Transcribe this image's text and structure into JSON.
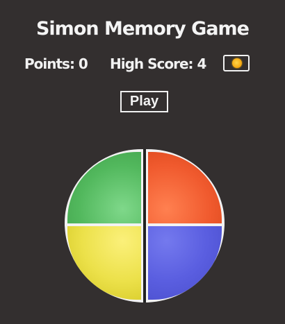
{
  "game": {
    "title": "Simon Memory Game",
    "points_label": "Points: 0",
    "highscore_label": "High Score: 4",
    "play_label": "Play",
    "theme_icon": "sun-icon"
  },
  "pads": [
    {
      "name": "green",
      "color": "#52b85d"
    },
    {
      "name": "red",
      "color": "#f05a2e"
    },
    {
      "name": "yellow",
      "color": "#ece14a"
    },
    {
      "name": "blue",
      "color": "#5a5ee0"
    }
  ],
  "colors": {
    "background": "#332f2f",
    "text": "#f2f2f2",
    "board_border": "#f2f2f2"
  }
}
